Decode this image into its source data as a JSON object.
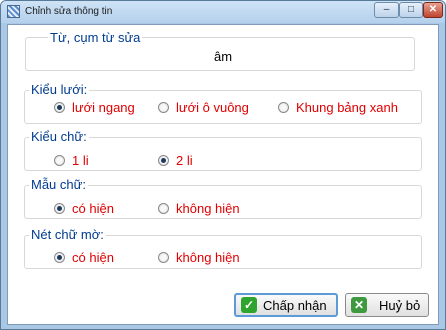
{
  "window": {
    "title": "Chỉnh sửa thông tin",
    "controls": {
      "minimize": "–",
      "maximize": "□",
      "close": "✕"
    }
  },
  "word_group": {
    "legend": "Từ, cụm từ sửa",
    "value": "âm"
  },
  "grid_type": {
    "legend": "Kiểu lưới:",
    "options": [
      {
        "label": "lưới ngang",
        "checked": true
      },
      {
        "label": "lưới ô vuông",
        "checked": false
      },
      {
        "label": "Khung bảng xanh",
        "checked": false
      }
    ]
  },
  "char_type": {
    "legend": "Kiểu chữ:",
    "options": [
      {
        "label": "1 li",
        "checked": false
      },
      {
        "label": "2 li",
        "checked": true
      }
    ]
  },
  "sample_char": {
    "legend": "Mẫu chữ:",
    "options": [
      {
        "label": "có hiện",
        "checked": true
      },
      {
        "label": "không hiện",
        "checked": false
      }
    ]
  },
  "faded_stroke": {
    "legend": "Nét chữ mờ:",
    "options": [
      {
        "label": "có hiện",
        "checked": true
      },
      {
        "label": "không hiện",
        "checked": false
      }
    ]
  },
  "buttons": {
    "ok": "Chấp nhận",
    "cancel": "Huỷ bỏ"
  },
  "icons": {
    "ok": "check-icon",
    "cancel": "x-icon"
  }
}
